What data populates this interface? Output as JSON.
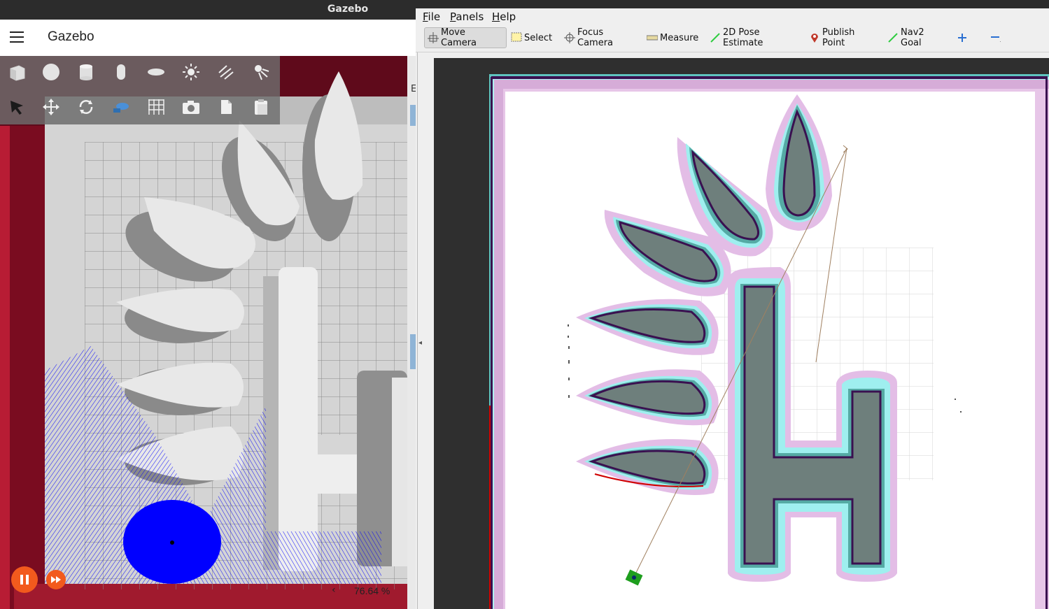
{
  "gazebo": {
    "window_title": "Gazebo",
    "app_title": "Gazebo",
    "toolbar": {
      "shapes": [
        {
          "icon": "box-icon"
        },
        {
          "icon": "sphere-icon"
        },
        {
          "icon": "cylinder-icon"
        },
        {
          "icon": "capsule-icon"
        },
        {
          "icon": "ellipsoid-icon"
        },
        {
          "icon": "point-light-icon"
        },
        {
          "icon": "directional-light-icon"
        },
        {
          "icon": "spot-light-icon"
        }
      ],
      "transforms": [
        {
          "icon": "select-cursor-icon"
        },
        {
          "icon": "translate-icon"
        },
        {
          "icon": "rotate-icon"
        },
        {
          "icon": "transform-control-icon"
        },
        {
          "icon": "grid-snap-icon"
        },
        {
          "icon": "screenshot-camera-icon"
        },
        {
          "icon": "copy-icon"
        },
        {
          "icon": "paste-icon"
        }
      ]
    },
    "playback": {
      "pause_icon": "pause-icon",
      "step_icon": "fast-forward-icon"
    },
    "real_time_factor": "76.64 %",
    "colors": {
      "accent": "#f25a1d",
      "scene_wall": "#6b0f1e",
      "lidar": "#0000ff"
    }
  },
  "rviz": {
    "window_title": "",
    "menus": [
      {
        "label": "File",
        "mnemonic": "F",
        "rest": "ile"
      },
      {
        "label": "Panels",
        "mnemonic": "P",
        "rest": "anels"
      },
      {
        "label": "Help",
        "mnemonic": "H",
        "rest": "elp"
      }
    ],
    "tools": [
      {
        "label": "Move Camera",
        "icon": "move-camera-icon",
        "active": true
      },
      {
        "label": "Select",
        "icon": "select-icon",
        "active": false
      },
      {
        "label": "Focus Camera",
        "icon": "focus-camera-icon",
        "active": false
      },
      {
        "label": "Measure",
        "icon": "measure-icon",
        "active": false
      },
      {
        "label": "2D Pose Estimate",
        "icon": "pose-estimate-arrow-icon",
        "active": false
      },
      {
        "label": "Publish Point",
        "icon": "publish-point-pin-icon",
        "active": false
      },
      {
        "label": "Nav2 Goal",
        "icon": "nav2-goal-arrow-icon",
        "active": false
      }
    ],
    "add_tool_icon": "plus-icon",
    "remove_tool_icon": "minus-icon",
    "colors": {
      "costmap_inflation": "#d8a8d8",
      "costmap_lethal": "#5aa8a0",
      "obstacle_fill": "#6f7f7c",
      "free_space": "#ffffff"
    }
  }
}
